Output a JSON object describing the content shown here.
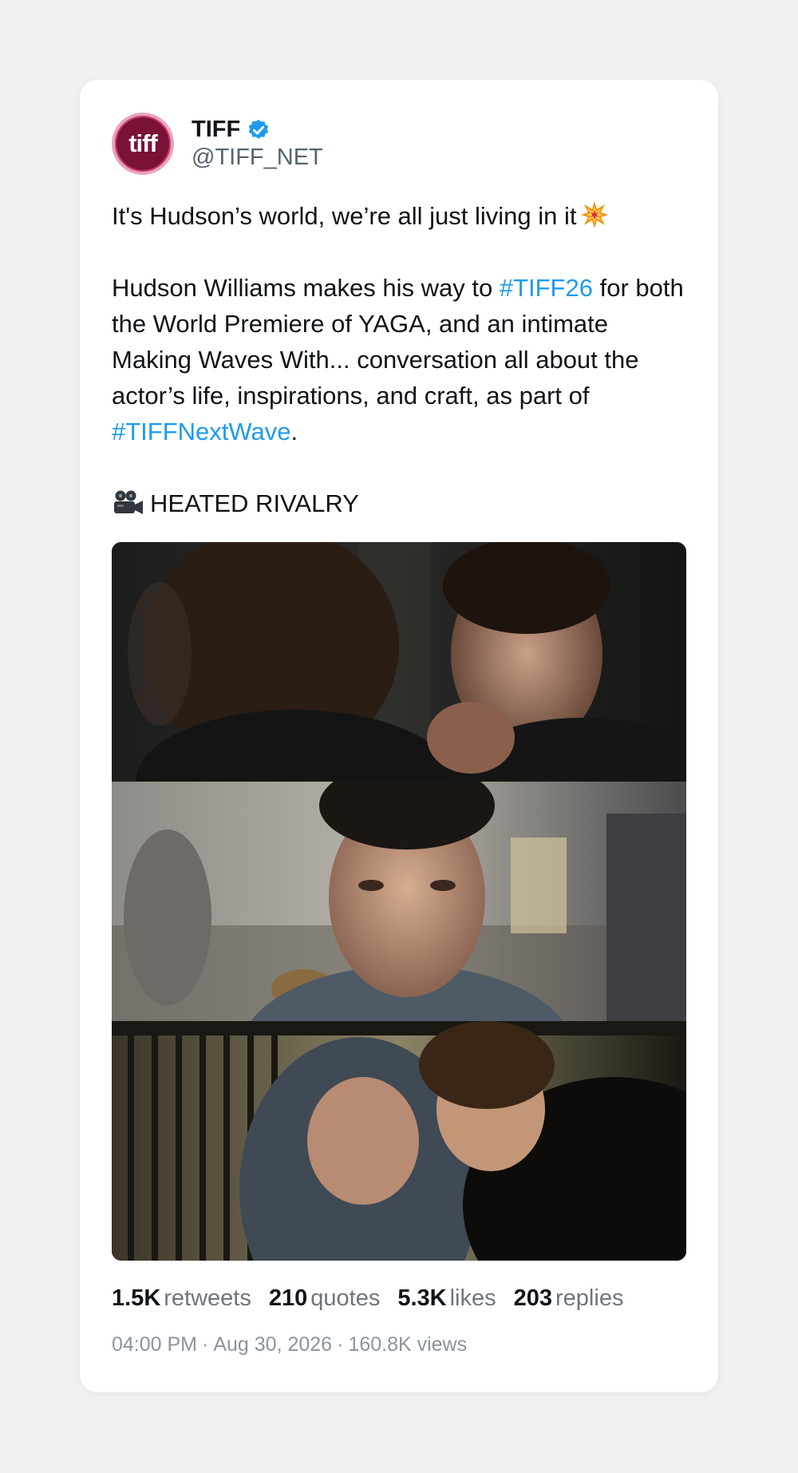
{
  "author": {
    "display_name": "TIFF",
    "handle": "@TIFF_NET",
    "avatar_text": "tiff",
    "verified": true
  },
  "tweet": {
    "line1": "It's Hudson’s world, we’re all just living in it",
    "p2_a": "Hudson Williams makes his way to ",
    "p2_tag1": "#TIFF26",
    "p2_b": " for both the World Premiere of YAGA, and an intimate Making Waves With... conversation all about the actor’s life, inspirations, and craft, as part of ",
    "p2_tag2": "#TIFFNextWave",
    "p2_c": ".",
    "credit": "HEATED RIVALRY"
  },
  "stats": [
    {
      "value": "1.5K",
      "label": "retweets"
    },
    {
      "value": "210",
      "label": "quotes"
    },
    {
      "value": "5.3K",
      "label": "likes"
    },
    {
      "value": "203",
      "label": "replies"
    }
  ],
  "meta": {
    "time": "04:00 PM",
    "date": "Aug 30, 2026",
    "views": "160.8K views"
  },
  "icons": {
    "verified": "verified-badge-icon",
    "burst": "collision-emoji-icon",
    "camera": "movie-camera-emoji-icon"
  },
  "colors": {
    "link": "#1d9bf0",
    "verified": "#1d9bf0",
    "avatar": "#7a1238"
  }
}
